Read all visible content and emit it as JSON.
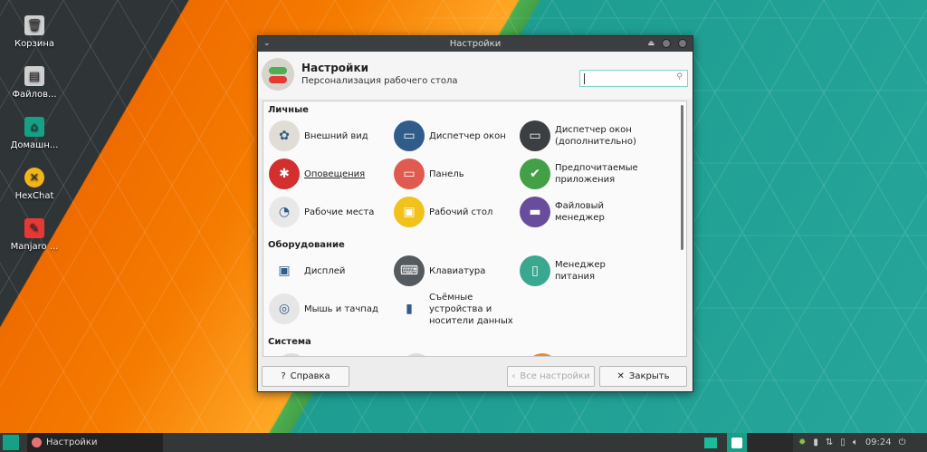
{
  "desktop": {
    "icons": [
      {
        "label": "Корзина",
        "icon": "trash-icon",
        "color": "#cfcfcf"
      },
      {
        "label": "Файлов...",
        "icon": "file-manager-icon",
        "color": "#cfcfcf"
      },
      {
        "label": "Домашн...",
        "icon": "home-folder-icon",
        "color": "#16a085"
      },
      {
        "label": "HexChat",
        "icon": "hexchat-icon",
        "color": "#f3b51a"
      },
      {
        "label": "Manjaro ...",
        "icon": "pdf-icon",
        "color": "#e53935"
      }
    ]
  },
  "window": {
    "title": "Настройки",
    "header_title": "Настройки",
    "header_subtitle": "Персонализация рабочего стола",
    "search_placeholder": ""
  },
  "sections": [
    {
      "title": "Личные",
      "items": [
        {
          "label": "Внешний вид",
          "icon": "appearance-icon",
          "color": "#e0ddd5",
          "glyph": "✿"
        },
        {
          "label": "Диспетчер окон",
          "icon": "window-manager-icon",
          "color": "#2f5c8a",
          "glyph": "▭"
        },
        {
          "label": "Диспетчер окон (дополнительно)",
          "icon": "window-manager-tweaks-icon",
          "color": "#3c3f41",
          "glyph": "▭"
        },
        {
          "label": "Оповещения",
          "icon": "notifications-icon",
          "color": "#d32f2f",
          "glyph": "✱"
        },
        {
          "label": "Панель",
          "icon": "panel-icon",
          "color": "#e05a4f",
          "glyph": "▭"
        },
        {
          "label": "Предпочитаемые приложения",
          "icon": "preferred-apps-icon",
          "color": "#43a047",
          "glyph": "✔"
        },
        {
          "label": "Рабочие места",
          "icon": "workspaces-icon",
          "color": "#e8e8e8",
          "glyph": "◔"
        },
        {
          "label": "Рабочий стол",
          "icon": "desktop-icon",
          "color": "#f2c21b",
          "glyph": "▣"
        },
        {
          "label": "Файловый менеджер",
          "icon": "file-manager-icon",
          "color": "#6a4c9c",
          "glyph": "▬"
        }
      ]
    },
    {
      "title": "Оборудование",
      "items": [
        {
          "label": "Дисплей",
          "icon": "display-icon",
          "color": "#fafafa",
          "glyph": "▣"
        },
        {
          "label": "Клавиатура",
          "icon": "keyboard-icon",
          "color": "#555a5e",
          "glyph": "⌨"
        },
        {
          "label": "Менеджер питания",
          "icon": "power-manager-icon",
          "color": "#3aa88f",
          "glyph": "▯"
        },
        {
          "label": "Мышь и тачпад",
          "icon": "mouse-icon",
          "color": "#e6e6e6",
          "glyph": "◎"
        },
        {
          "label": "Съёмные устройства и носители данных",
          "icon": "removable-drives-icon",
          "color": "#fafafa",
          "glyph": "▮"
        }
      ]
    },
    {
      "title": "Система",
      "items": []
    }
  ],
  "buttons": {
    "help": "Справка",
    "all_settings": "Все настройки",
    "close": "Закрыть"
  },
  "taskbar": {
    "task_label": "Настройки",
    "clock": "09:24"
  }
}
